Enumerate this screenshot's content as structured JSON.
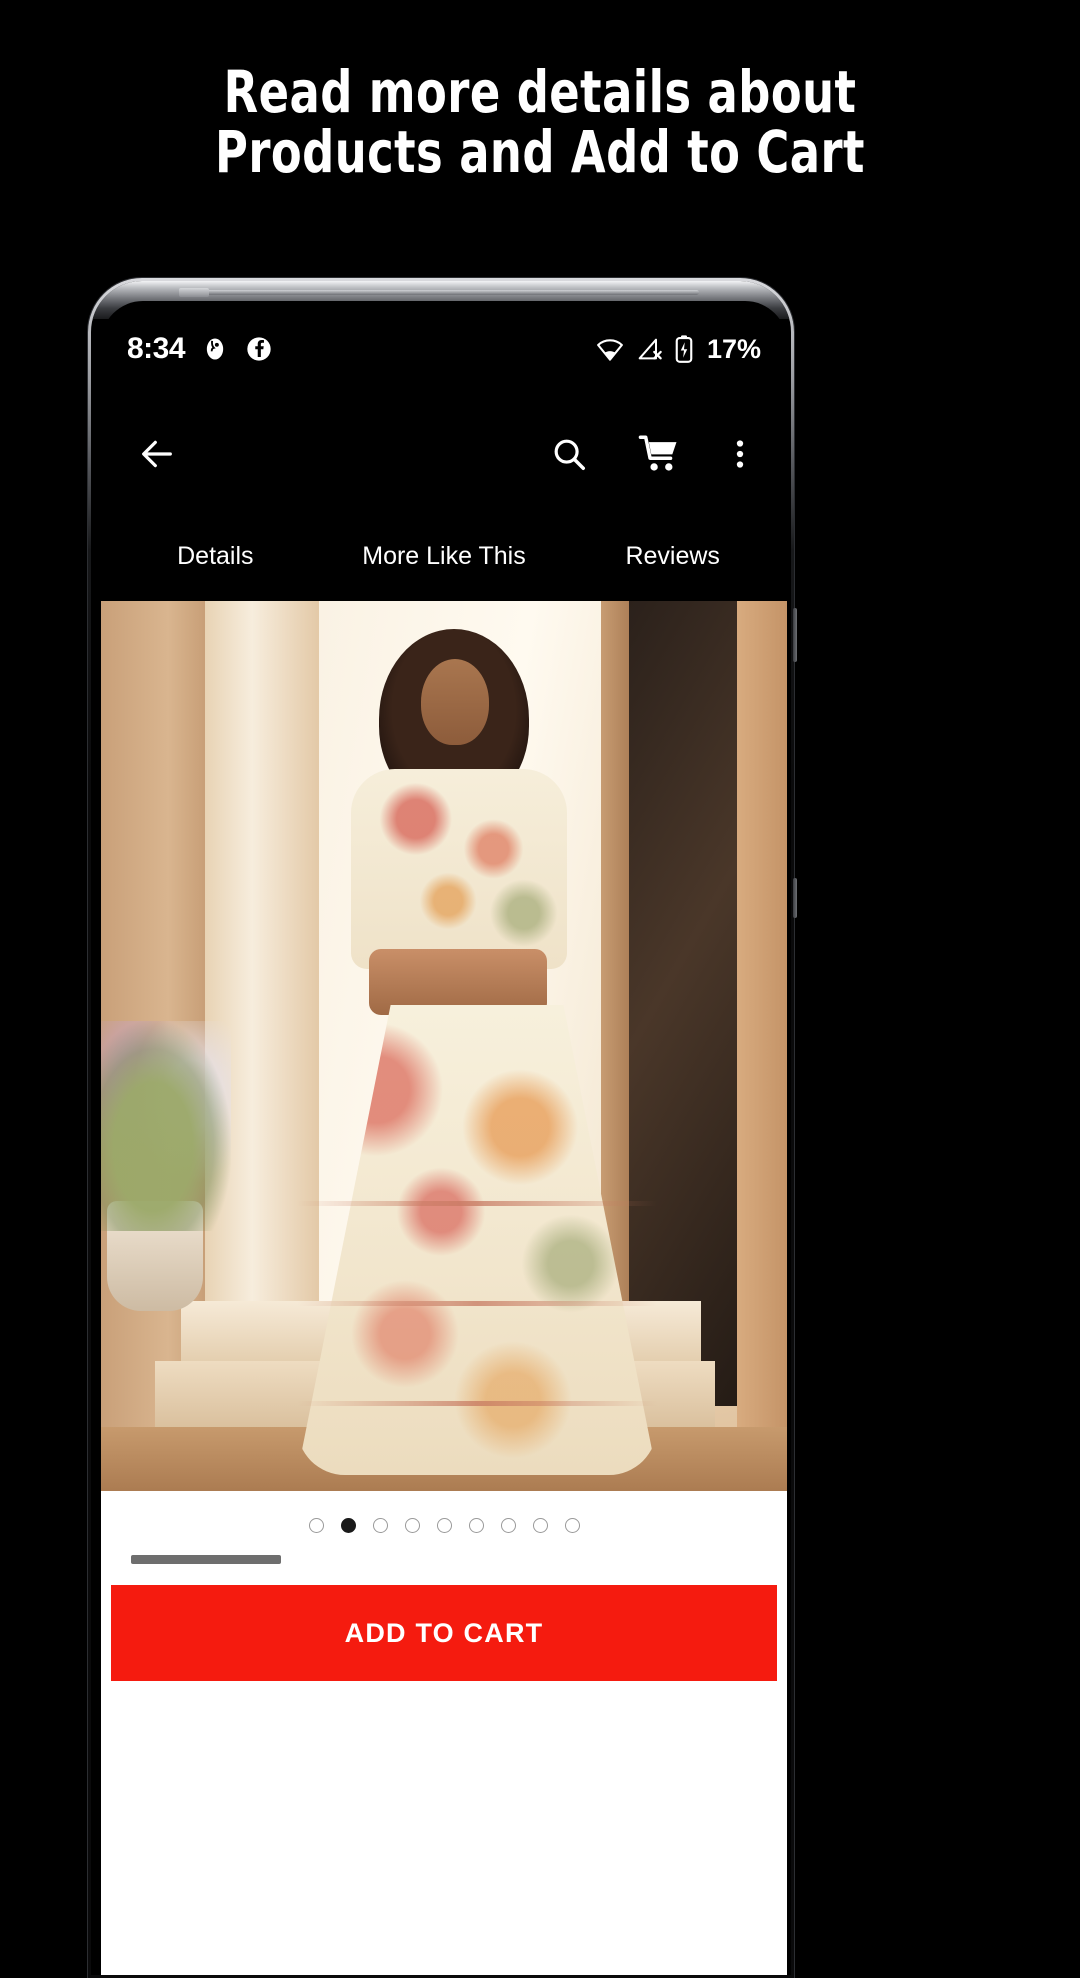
{
  "promo": {
    "headline_line1": "Read more details about",
    "headline_line2": "Products and Add to Cart"
  },
  "colors": {
    "background": "#000000",
    "accent_cta": "#F51B0F",
    "text_light": "#FFFFFF",
    "dot_active": "#1A1A1A",
    "dot_inactive": "#9A9A9A"
  },
  "phone": {
    "status_bar": {
      "clock": "8:34",
      "notification_icons": [
        "app-notification-icon",
        "facebook-icon"
      ],
      "wifi_icon": "wifi-icon",
      "signal_icon": "cellular-signal-off-icon",
      "battery_icon": "battery-charging-icon",
      "battery_percent": "17%"
    },
    "toolbar": {
      "back_icon": "back-arrow-icon",
      "search_icon": "search-icon",
      "cart_icon": "shopping-cart-icon",
      "overflow_icon": "more-vertical-icon"
    },
    "tabs": [
      {
        "label": "Details",
        "active": false
      },
      {
        "label": "More Like This",
        "active": false
      },
      {
        "label": "Reviews",
        "active": false
      }
    ],
    "gallery": {
      "image_alt": "Model wearing floral print tiered maxi dress with brown belt",
      "total_dots": 9,
      "active_dot_index": 1
    },
    "cta": {
      "add_to_cart_label": "ADD TO CART"
    }
  }
}
